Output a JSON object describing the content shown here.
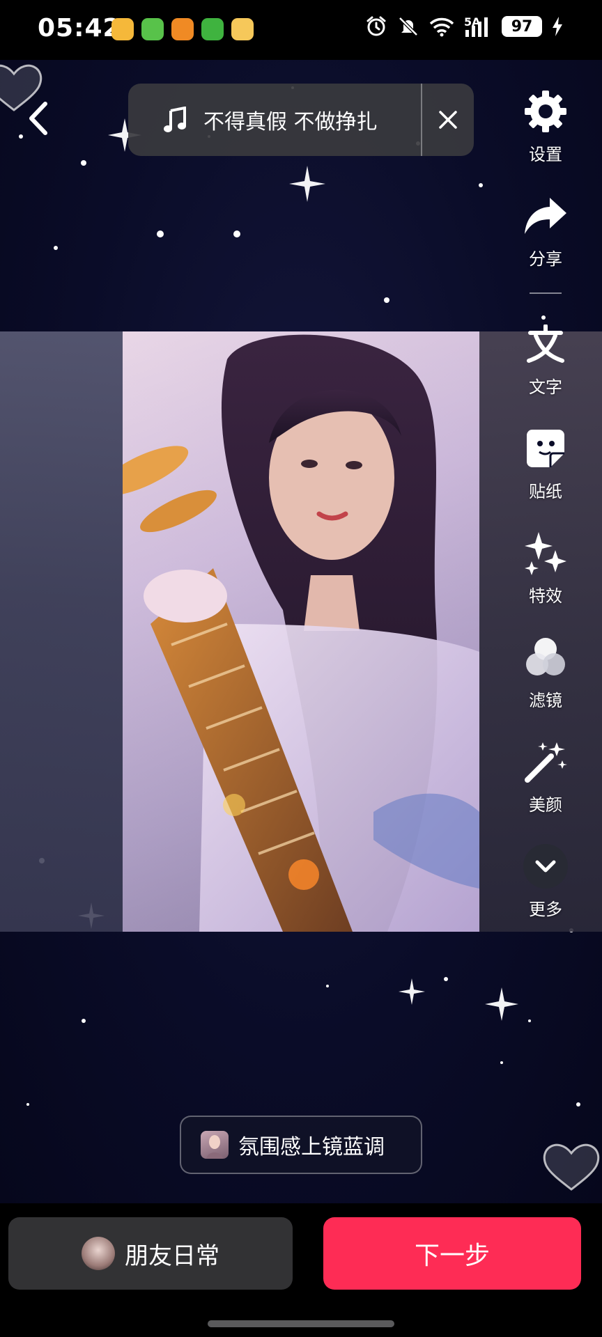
{
  "status_bar": {
    "time": "05:42",
    "network": "5A",
    "battery": "97",
    "app_icons": [
      "weibo-icon",
      "app-green-icon",
      "app-orange-icon",
      "wechat-icon",
      "app-yellow-icon"
    ]
  },
  "music": {
    "title": "不得真假 不做挣扎"
  },
  "tools": {
    "settings": "设置",
    "share": "分享",
    "text": "文字",
    "sticker": "贴纸",
    "effects": "特效",
    "filter": "滤镜",
    "beauty": "美颜",
    "more": "更多"
  },
  "template": {
    "label": "氛围感上镜蓝调"
  },
  "bottom": {
    "friends_label": "朋友日常",
    "next_label": "下一步"
  },
  "colors": {
    "accent": "#fe2c55",
    "background": "#0a0c28"
  }
}
